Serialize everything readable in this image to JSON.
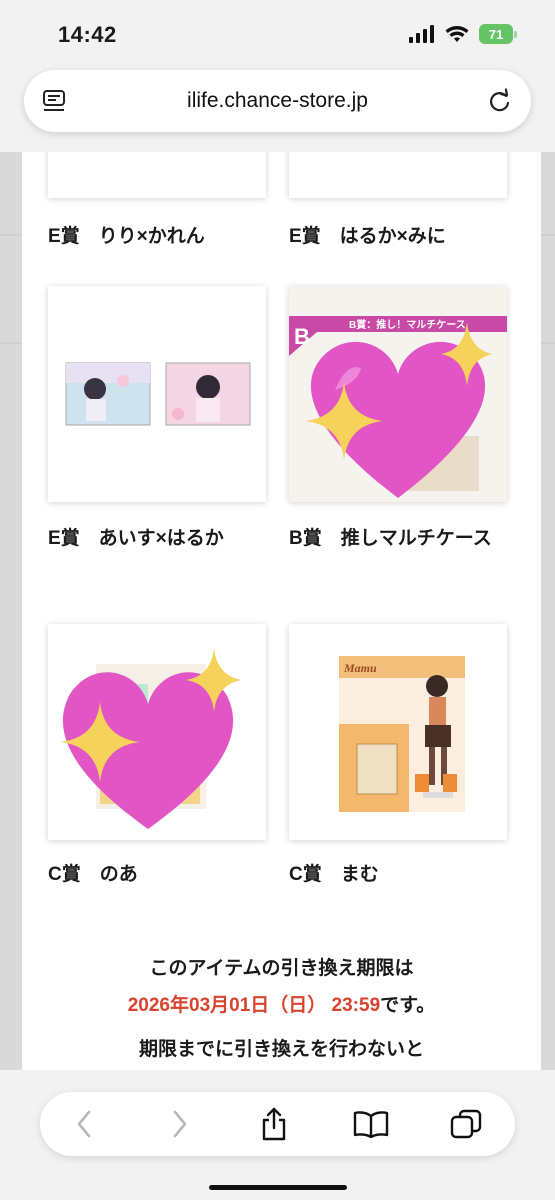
{
  "status_bar": {
    "time": "14:42",
    "battery": "71"
  },
  "browser": {
    "url": "ilife.chance-store.jp"
  },
  "prizes": [
    {
      "label": "E賞　りり×かれん"
    },
    {
      "label": "E賞　はるか×みに"
    },
    {
      "label": "E賞　あいす×はるか"
    },
    {
      "label": "B賞　推しマルチケース"
    },
    {
      "label": "C賞　のあ"
    },
    {
      "label": "C賞　まむ"
    }
  ],
  "image_text": {
    "b_badge": "B",
    "b_header": "B賞：推し！マルチケース",
    "stand_name": "Mamu"
  },
  "expiry": {
    "line1": "このアイテムの引き換え期限は",
    "date": "2026年03月01日（日） 23:59",
    "suffix": "です。",
    "line3": "期限までに引き換えを行わないと"
  },
  "colors": {
    "accent_red": "#d9432f",
    "heart": "#e255c4",
    "sparkle": "#f6d25a"
  }
}
